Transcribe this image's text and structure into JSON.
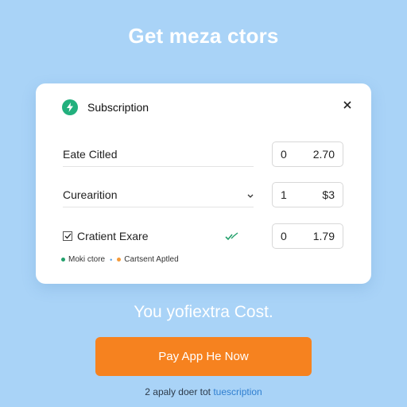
{
  "headline": "Get meza ctors",
  "card": {
    "title": "Subscription",
    "rows": [
      {
        "label": "Eate Citled",
        "qty": "0",
        "price": "2.70"
      },
      {
        "label": "Curearition",
        "qty": "1",
        "price": "$3"
      },
      {
        "label": "Cratient Exare",
        "qty": "0",
        "price": "1.79"
      }
    ],
    "legend": {
      "item1": "Moki ctore",
      "item2": "Cartsent Aptled",
      "color1": "#22a06b",
      "color2": "#f39a3b"
    },
    "icons": {
      "logo": "lightning-icon",
      "close": "close-icon",
      "dropdown": "chevron-down-icon",
      "checked": "checkmark-icon"
    }
  },
  "sub_headline": "You yofiextra Cost.",
  "cta_label": "Pay App He Now",
  "footer": {
    "prefix": "2 apaly doer tot",
    "link": "tuescription"
  },
  "colors": {
    "background": "#a9d3f7",
    "accent": "#f6821f",
    "brand": "#22b07d"
  }
}
